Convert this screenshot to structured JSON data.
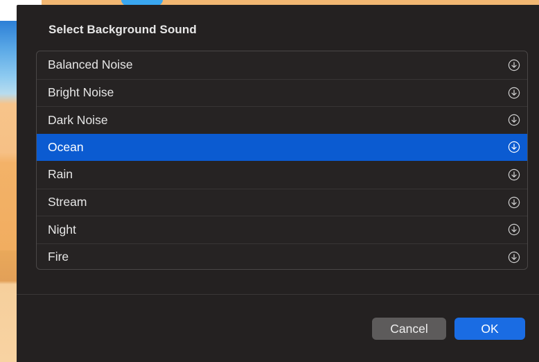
{
  "dialog": {
    "title": "Select Background Sound",
    "items": [
      {
        "label": "Balanced Noise",
        "icon": "download-icon",
        "selected": false
      },
      {
        "label": "Bright Noise",
        "icon": "download-icon",
        "selected": false
      },
      {
        "label": "Dark Noise",
        "icon": "download-icon",
        "selected": false
      },
      {
        "label": "Ocean",
        "icon": "download-icon",
        "selected": true
      },
      {
        "label": "Rain",
        "icon": "download-icon",
        "selected": false
      },
      {
        "label": "Stream",
        "icon": "download-icon",
        "selected": false
      },
      {
        "label": "Night",
        "icon": "download-icon",
        "selected": false
      },
      {
        "label": "Fire",
        "icon": "download-icon",
        "selected": false
      }
    ],
    "buttons": {
      "cancel_label": "Cancel",
      "ok_label": "OK"
    }
  },
  "colors": {
    "sheet_background": "#242121",
    "selection": "#0b5bd1",
    "ok_button": "#1a6ce3",
    "cancel_button": "#5d5b5b"
  }
}
